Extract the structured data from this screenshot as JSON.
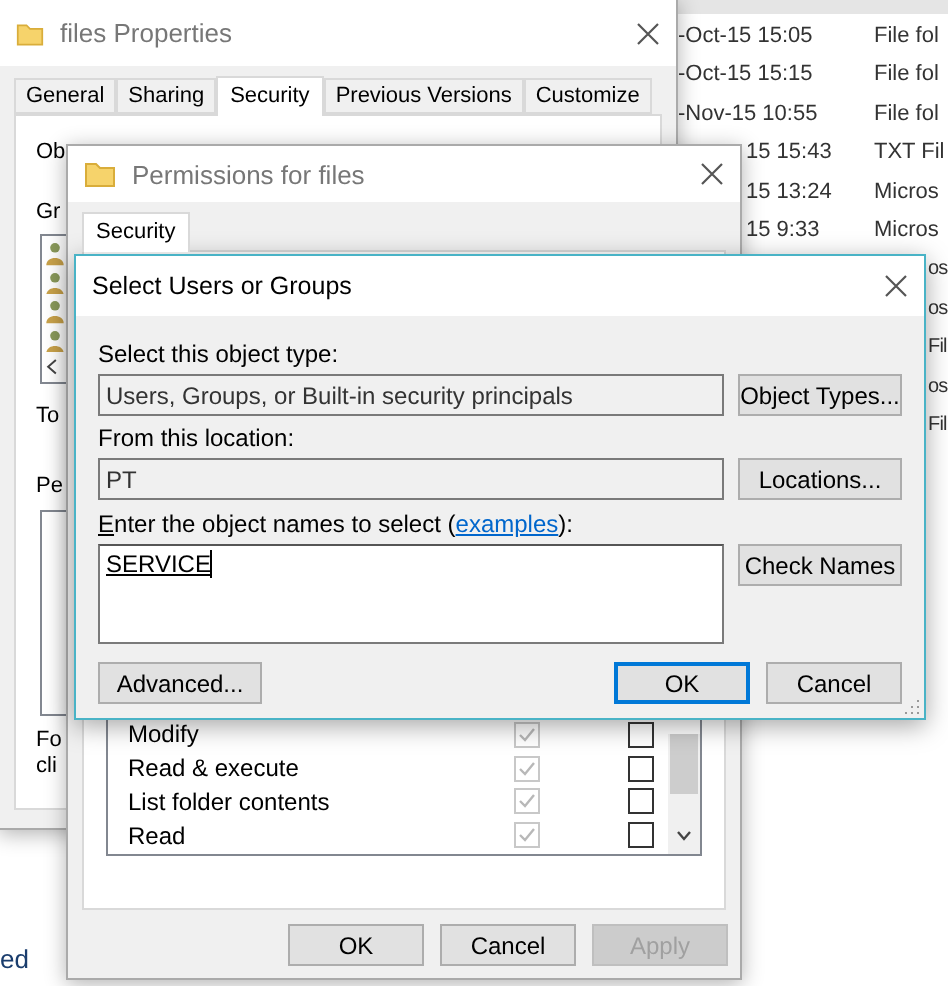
{
  "explorer": {
    "rows": [
      {
        "kind": "full",
        "date": "-Oct-15 15:05",
        "type": "File fol"
      },
      {
        "kind": "full",
        "date": "-Oct-15 15:15",
        "type": "File fol"
      },
      {
        "kind": "full",
        "date": "-Nov-15 10:55",
        "type": "File fol"
      },
      {
        "kind": "covered",
        "date": "15 15:43",
        "type": "TXT Fil"
      },
      {
        "kind": "covered",
        "date": "15 13:24",
        "type": "Micros"
      },
      {
        "kind": "covered",
        "date": "15 9:33",
        "type": "Micros"
      },
      {
        "kind": "edge",
        "type": "os"
      },
      {
        "kind": "edge",
        "type": "os"
      },
      {
        "kind": "edge",
        "type": "Fil"
      },
      {
        "kind": "edge",
        "type": "os"
      },
      {
        "kind": "edge",
        "type": "Fil"
      }
    ],
    "footer": "ed"
  },
  "properties": {
    "title": "files Properties",
    "tabs": [
      {
        "label": "General",
        "selected": false
      },
      {
        "label": "Sharing",
        "selected": false
      },
      {
        "label": "Security",
        "selected": true
      },
      {
        "label": "Previous Versions",
        "selected": false
      },
      {
        "label": "Customize",
        "selected": false
      }
    ],
    "object_name_label": "Ob",
    "groups_label": "Gr",
    "to_label": "To",
    "permissions_label": "Pe",
    "footer_lines": [
      "Fo",
      "cli"
    ]
  },
  "permissions_dialog": {
    "title": "Permissions for files",
    "tabs": [
      {
        "label": "Security",
        "selected": true
      }
    ],
    "entries": [
      {
        "name": "Modify",
        "allow": true,
        "allow_disabled": true,
        "deny": false
      },
      {
        "name": "Read & execute",
        "allow": true,
        "allow_disabled": true,
        "deny": false
      },
      {
        "name": "List folder contents",
        "allow": true,
        "allow_disabled": true,
        "deny": false
      },
      {
        "name": "Read",
        "allow": true,
        "allow_disabled": true,
        "deny": false
      }
    ],
    "buttons": [
      {
        "label": "OK",
        "disabled": false
      },
      {
        "label": "Cancel",
        "disabled": false
      },
      {
        "label": "Apply",
        "disabled": true
      }
    ]
  },
  "select_dialog": {
    "title": "Select Users or Groups",
    "object_type_label": "Select this object type:",
    "object_type": "Users, Groups, or Built-in security principals",
    "location_label": "From this location:",
    "location": "PT",
    "names_label_before": "Enter the object names to select (",
    "names_link": "examples",
    "names_label_after": "):",
    "names_value": "SERVICE",
    "object_types_button": "Object Types...",
    "locations_button": "Locations...",
    "check_names_button": "Check Names",
    "advanced_button": "Advanced...",
    "ok_button": "OK",
    "cancel_button": "Cancel"
  }
}
